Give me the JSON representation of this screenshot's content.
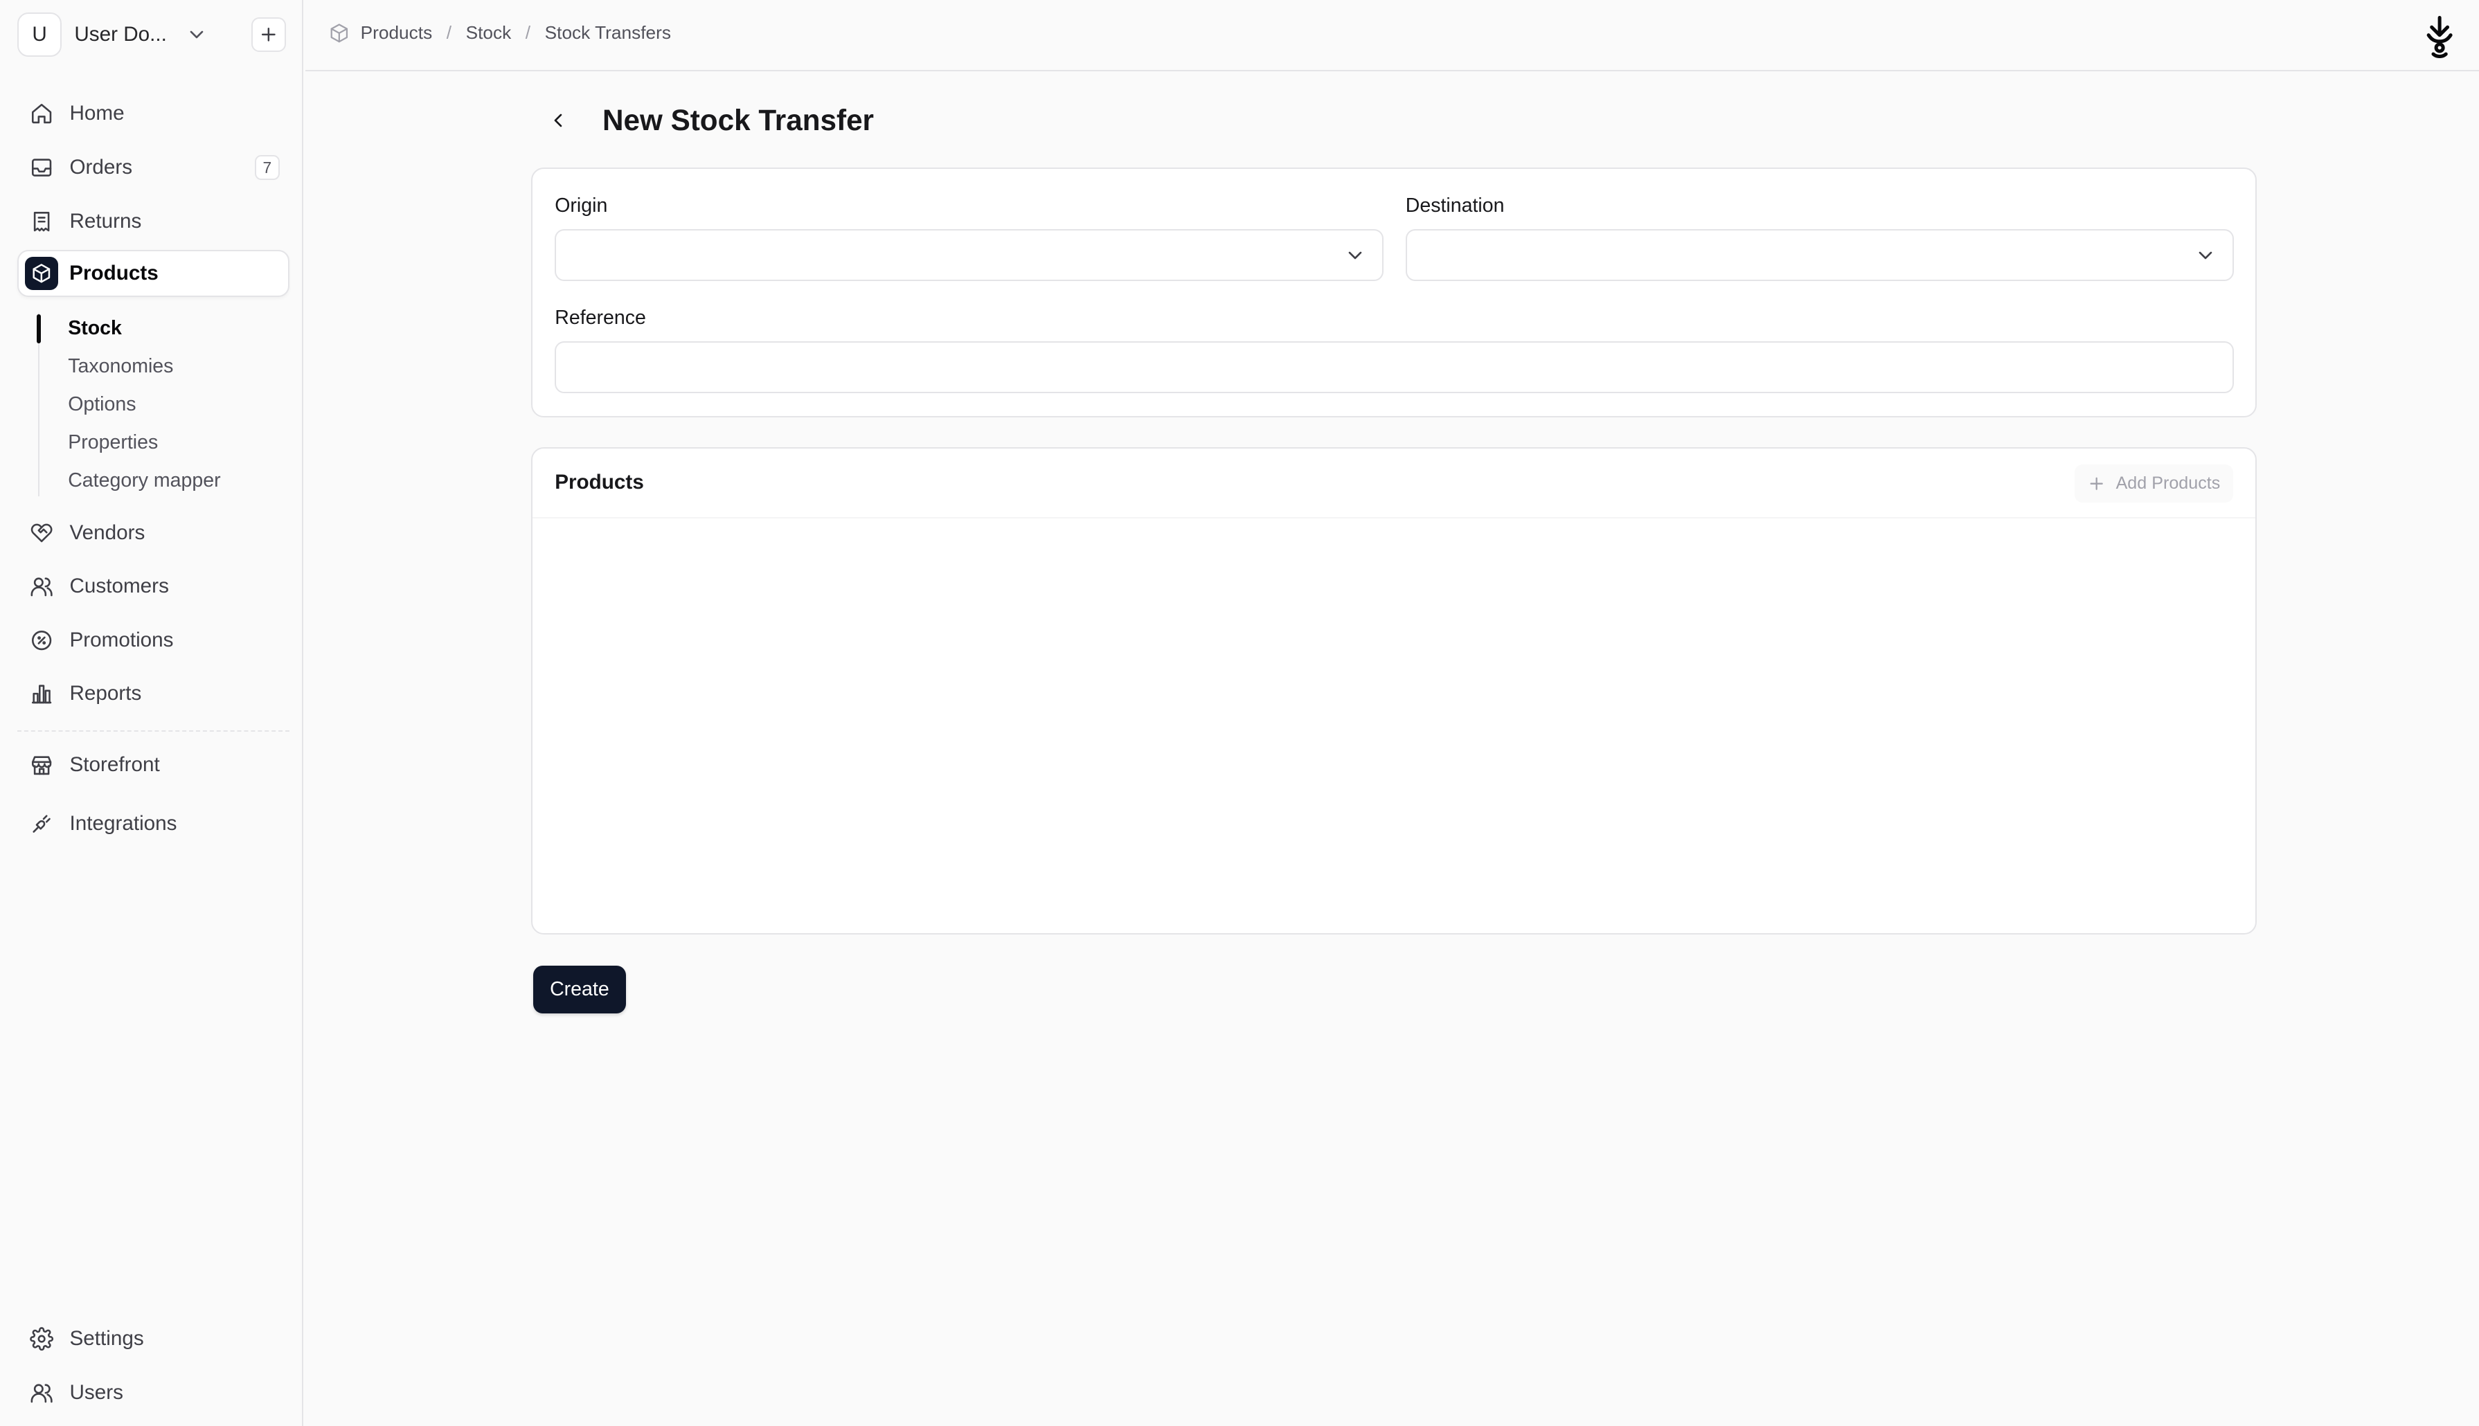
{
  "sidebar": {
    "store": {
      "avatar": "U",
      "name": "User Do..."
    },
    "nav": [
      {
        "label": "Home",
        "icon": "home-icon"
      },
      {
        "label": "Orders",
        "icon": "inbox-icon",
        "badge": "7"
      },
      {
        "label": "Returns",
        "icon": "receipt-icon"
      },
      {
        "label": "Products",
        "icon": "box-icon",
        "active": true
      }
    ],
    "products_sub": [
      {
        "label": "Stock",
        "active": true
      },
      {
        "label": "Taxonomies"
      },
      {
        "label": "Options"
      },
      {
        "label": "Properties"
      },
      {
        "label": "Category mapper"
      }
    ],
    "nav2": [
      {
        "label": "Vendors",
        "icon": "handshake-icon"
      },
      {
        "label": "Customers",
        "icon": "users-icon"
      },
      {
        "label": "Promotions",
        "icon": "percent-icon"
      },
      {
        "label": "Reports",
        "icon": "bar-chart-icon"
      }
    ],
    "nav3": [
      {
        "label": "Storefront",
        "icon": "store-icon"
      },
      {
        "label": "Integrations",
        "icon": "plug-icon"
      }
    ],
    "bottom": [
      {
        "label": "Settings",
        "icon": "gear-icon"
      },
      {
        "label": "Users",
        "icon": "users-icon"
      }
    ]
  },
  "breadcrumb": [
    "Products",
    "Stock",
    "Stock Transfers"
  ],
  "page": {
    "title": "New Stock Transfer"
  },
  "form": {
    "origin_label": "Origin",
    "origin_value": "",
    "destination_label": "Destination",
    "destination_value": "",
    "reference_label": "Reference",
    "reference_value": ""
  },
  "products_card": {
    "title": "Products",
    "add_label": "Add Products"
  },
  "actions": {
    "create_label": "Create"
  },
  "colors": {
    "primary": "#0f172a",
    "border": "#e4e4e7",
    "background": "#fafafa"
  }
}
